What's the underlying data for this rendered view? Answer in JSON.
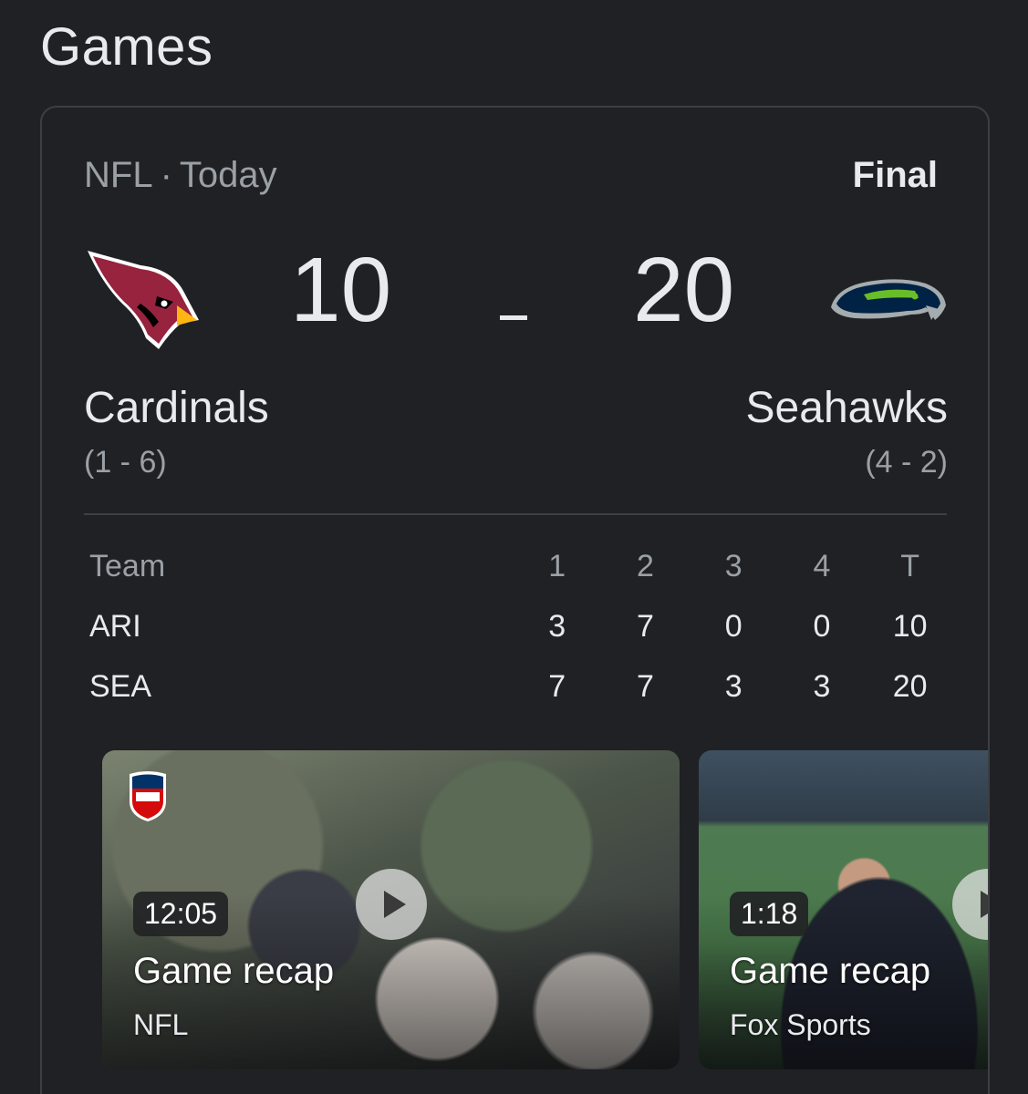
{
  "section_title": "Games",
  "game": {
    "league": "NFL",
    "day": "Today",
    "status": "Final",
    "home": {
      "name": "Cardinals",
      "abbr": "ARI",
      "record": "(1 - 6)",
      "score": "10",
      "logo": "cardinals-logo",
      "color": "#97233F"
    },
    "away": {
      "name": "Seahawks",
      "abbr": "SEA",
      "record": "(4 - 2)",
      "score": "20",
      "logo": "seahawks-logo",
      "color": "#002244"
    },
    "score_separator": "-"
  },
  "linescore": {
    "headers": [
      "Team",
      "1",
      "2",
      "3",
      "4",
      "T"
    ],
    "rows": [
      [
        "ARI",
        "3",
        "7",
        "0",
        "0",
        "10"
      ],
      [
        "SEA",
        "7",
        "7",
        "3",
        "3",
        "20"
      ]
    ]
  },
  "videos": [
    {
      "duration": "12:05",
      "title": "Game recap",
      "source": "NFL",
      "icon": "play-icon"
    },
    {
      "duration": "1:18",
      "title": "Game recap",
      "source": "Fox Sports",
      "icon": "play-icon"
    }
  ]
}
